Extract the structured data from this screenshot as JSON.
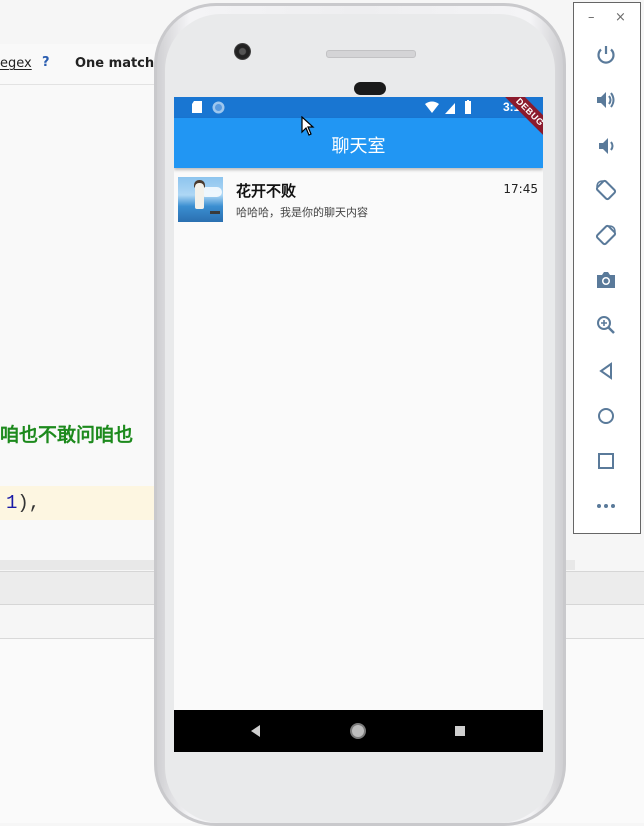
{
  "ide": {
    "regex_label": "egex",
    "help_label": "?",
    "match_label": "One match",
    "chinese_line": "咱也不敢问咱也",
    "code_num": "1",
    "code_tail": "),"
  },
  "phone": {
    "statusbar": {
      "time": "3:15"
    },
    "appbar": {
      "title": "聊天室",
      "debug_banner": "DEBUG"
    },
    "chats": [
      {
        "name": "花开不败",
        "preview": "哈哈哈，我是你的聊天内容",
        "time": "17:45"
      }
    ]
  },
  "emulator_toolbar": {
    "minimize_label": "–",
    "close_label": "×",
    "buttons": [
      "power-icon",
      "volume-up-icon",
      "volume-down-icon",
      "rotate-left-icon",
      "rotate-right-icon",
      "camera-icon",
      "zoom-icon",
      "back-icon",
      "home-icon",
      "overview-icon",
      "more-icon"
    ]
  },
  "colors": {
    "statusbar": "#1976d2",
    "appbar": "#2196f3",
    "ide_green": "#1d8a1d",
    "toolbar_icon": "#5a7a9a"
  }
}
